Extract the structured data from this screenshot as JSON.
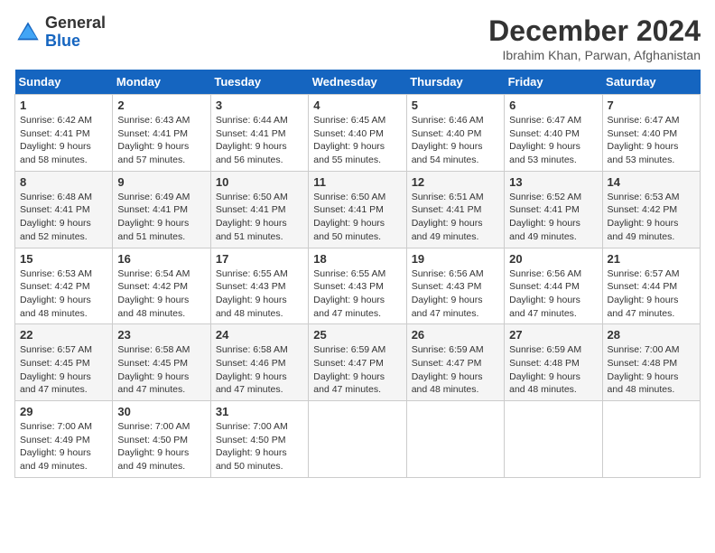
{
  "header": {
    "logo_line1": "General",
    "logo_line2": "Blue",
    "title": "December 2024",
    "location": "Ibrahim Khan, Parwan, Afghanistan"
  },
  "days_of_week": [
    "Sunday",
    "Monday",
    "Tuesday",
    "Wednesday",
    "Thursday",
    "Friday",
    "Saturday"
  ],
  "weeks": [
    [
      {
        "day": "1",
        "sunrise": "6:42 AM",
        "sunset": "4:41 PM",
        "daylight": "9 hours and 58 minutes."
      },
      {
        "day": "2",
        "sunrise": "6:43 AM",
        "sunset": "4:41 PM",
        "daylight": "9 hours and 57 minutes."
      },
      {
        "day": "3",
        "sunrise": "6:44 AM",
        "sunset": "4:41 PM",
        "daylight": "9 hours and 56 minutes."
      },
      {
        "day": "4",
        "sunrise": "6:45 AM",
        "sunset": "4:40 PM",
        "daylight": "9 hours and 55 minutes."
      },
      {
        "day": "5",
        "sunrise": "6:46 AM",
        "sunset": "4:40 PM",
        "daylight": "9 hours and 54 minutes."
      },
      {
        "day": "6",
        "sunrise": "6:47 AM",
        "sunset": "4:40 PM",
        "daylight": "9 hours and 53 minutes."
      },
      {
        "day": "7",
        "sunrise": "6:47 AM",
        "sunset": "4:40 PM",
        "daylight": "9 hours and 53 minutes."
      }
    ],
    [
      {
        "day": "8",
        "sunrise": "6:48 AM",
        "sunset": "4:41 PM",
        "daylight": "9 hours and 52 minutes."
      },
      {
        "day": "9",
        "sunrise": "6:49 AM",
        "sunset": "4:41 PM",
        "daylight": "9 hours and 51 minutes."
      },
      {
        "day": "10",
        "sunrise": "6:50 AM",
        "sunset": "4:41 PM",
        "daylight": "9 hours and 51 minutes."
      },
      {
        "day": "11",
        "sunrise": "6:50 AM",
        "sunset": "4:41 PM",
        "daylight": "9 hours and 50 minutes."
      },
      {
        "day": "12",
        "sunrise": "6:51 AM",
        "sunset": "4:41 PM",
        "daylight": "9 hours and 49 minutes."
      },
      {
        "day": "13",
        "sunrise": "6:52 AM",
        "sunset": "4:41 PM",
        "daylight": "9 hours and 49 minutes."
      },
      {
        "day": "14",
        "sunrise": "6:53 AM",
        "sunset": "4:42 PM",
        "daylight": "9 hours and 49 minutes."
      }
    ],
    [
      {
        "day": "15",
        "sunrise": "6:53 AM",
        "sunset": "4:42 PM",
        "daylight": "9 hours and 48 minutes."
      },
      {
        "day": "16",
        "sunrise": "6:54 AM",
        "sunset": "4:42 PM",
        "daylight": "9 hours and 48 minutes."
      },
      {
        "day": "17",
        "sunrise": "6:55 AM",
        "sunset": "4:43 PM",
        "daylight": "9 hours and 48 minutes."
      },
      {
        "day": "18",
        "sunrise": "6:55 AM",
        "sunset": "4:43 PM",
        "daylight": "9 hours and 47 minutes."
      },
      {
        "day": "19",
        "sunrise": "6:56 AM",
        "sunset": "4:43 PM",
        "daylight": "9 hours and 47 minutes."
      },
      {
        "day": "20",
        "sunrise": "6:56 AM",
        "sunset": "4:44 PM",
        "daylight": "9 hours and 47 minutes."
      },
      {
        "day": "21",
        "sunrise": "6:57 AM",
        "sunset": "4:44 PM",
        "daylight": "9 hours and 47 minutes."
      }
    ],
    [
      {
        "day": "22",
        "sunrise": "6:57 AM",
        "sunset": "4:45 PM",
        "daylight": "9 hours and 47 minutes."
      },
      {
        "day": "23",
        "sunrise": "6:58 AM",
        "sunset": "4:45 PM",
        "daylight": "9 hours and 47 minutes."
      },
      {
        "day": "24",
        "sunrise": "6:58 AM",
        "sunset": "4:46 PM",
        "daylight": "9 hours and 47 minutes."
      },
      {
        "day": "25",
        "sunrise": "6:59 AM",
        "sunset": "4:47 PM",
        "daylight": "9 hours and 47 minutes."
      },
      {
        "day": "26",
        "sunrise": "6:59 AM",
        "sunset": "4:47 PM",
        "daylight": "9 hours and 48 minutes."
      },
      {
        "day": "27",
        "sunrise": "6:59 AM",
        "sunset": "4:48 PM",
        "daylight": "9 hours and 48 minutes."
      },
      {
        "day": "28",
        "sunrise": "7:00 AM",
        "sunset": "4:48 PM",
        "daylight": "9 hours and 48 minutes."
      }
    ],
    [
      {
        "day": "29",
        "sunrise": "7:00 AM",
        "sunset": "4:49 PM",
        "daylight": "9 hours and 49 minutes."
      },
      {
        "day": "30",
        "sunrise": "7:00 AM",
        "sunset": "4:50 PM",
        "daylight": "9 hours and 49 minutes."
      },
      {
        "day": "31",
        "sunrise": "7:00 AM",
        "sunset": "4:50 PM",
        "daylight": "9 hours and 50 minutes."
      },
      null,
      null,
      null,
      null
    ]
  ]
}
